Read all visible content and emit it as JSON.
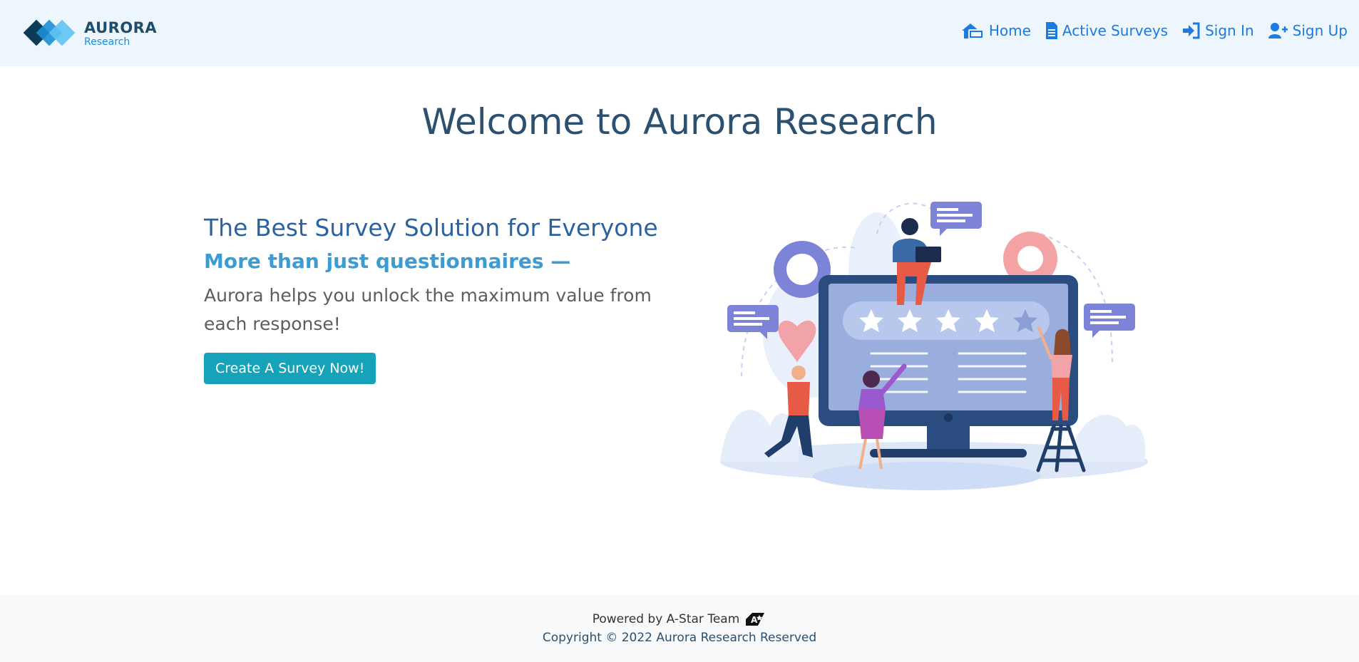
{
  "brand": {
    "name": "AURORA",
    "subtitle": "Research"
  },
  "nav": {
    "items": [
      {
        "label": "Home",
        "icon": "home-icon"
      },
      {
        "label": "Active Surveys",
        "icon": "document-icon"
      },
      {
        "label": "Sign In",
        "icon": "sign-in-icon"
      },
      {
        "label": "Sign Up",
        "icon": "user-plus-icon"
      }
    ]
  },
  "main": {
    "title": "Welcome to Aurora Research",
    "heading": "The Best Survey Solution for Everyone",
    "subheading": "More than just questionnaires —",
    "description": "Aurora helps you unlock the maximum value from each response!",
    "cta_label": "Create A Survey Now!"
  },
  "footer": {
    "powered_by": "Powered by A-Star Team",
    "copyright": "Copyright © 2022 Aurora Research Reserved"
  },
  "colors": {
    "nav_bg": "#edf5fd",
    "link": "#1c7ae0",
    "title": "#2c5070",
    "cta": "#16a2b8",
    "footer_bg": "#f8f9fa"
  }
}
